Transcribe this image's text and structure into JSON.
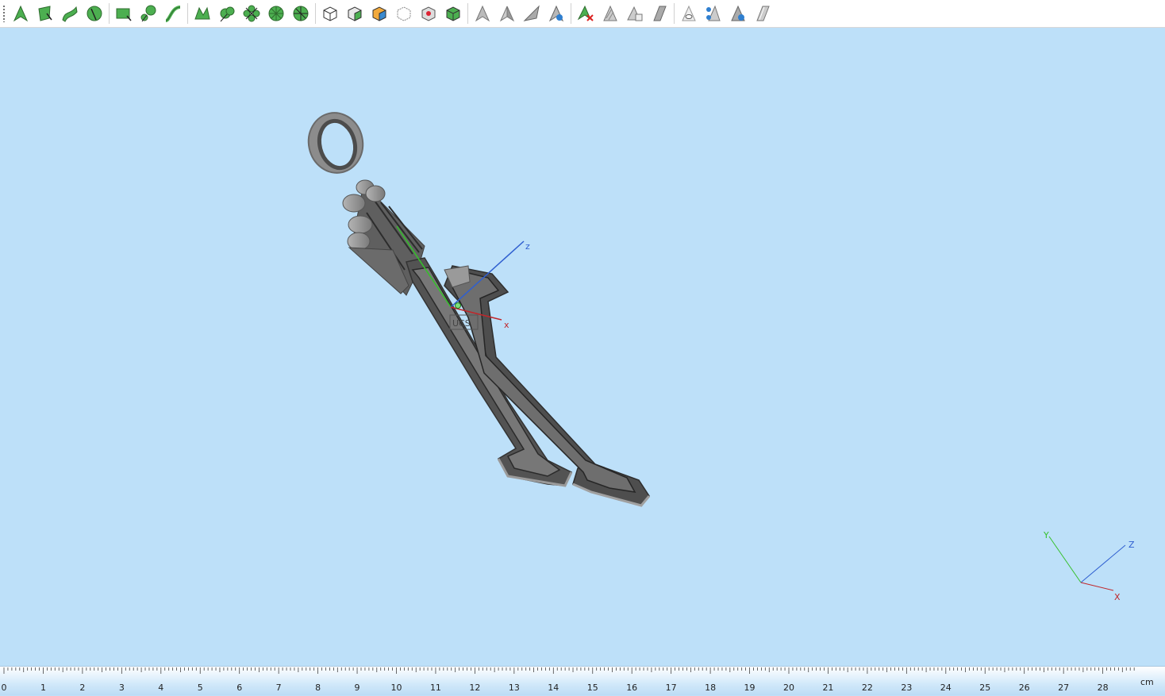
{
  "toolbar": {
    "groups": [
      [
        {
          "name": "select-curve-tool",
          "icon": "arrow-select-icon"
        },
        {
          "name": "select-surface-tool",
          "icon": "surface-select-icon"
        },
        {
          "name": "select-freeform-tool",
          "icon": "freeform-select-icon"
        },
        {
          "name": "select-round-tool",
          "icon": "round-select-icon"
        }
      ],
      [
        {
          "name": "rectangle-patch-tool",
          "icon": "rectangle-patch-icon"
        },
        {
          "name": "node-link-tool",
          "icon": "node-link-icon"
        },
        {
          "name": "curve-sweep-tool",
          "icon": "curve-sweep-icon"
        }
      ],
      [
        {
          "name": "trim-tool",
          "icon": "trim-icon"
        },
        {
          "name": "blend-tool",
          "icon": "blend-icon"
        },
        {
          "name": "flower-pattern-tool",
          "icon": "flower-pattern-icon"
        },
        {
          "name": "radial-pattern-tool",
          "icon": "radial-pattern-icon"
        },
        {
          "name": "radial-cut-tool",
          "icon": "radial-cut-icon"
        }
      ],
      [
        {
          "name": "box-view-tool",
          "icon": "box-icon"
        },
        {
          "name": "box-shaded-tool",
          "icon": "box-shaded-icon"
        },
        {
          "name": "box-colored-tool",
          "icon": "box-colored-icon"
        },
        {
          "name": "box-wire-tool",
          "icon": "box-wire-icon"
        },
        {
          "name": "box-red-point-tool",
          "icon": "box-red-point-icon"
        },
        {
          "name": "box-green-tool",
          "icon": "box-green-icon"
        }
      ],
      [
        {
          "name": "pointer-gray-tool",
          "icon": "pointer-gray-icon"
        },
        {
          "name": "pointer-split-tool",
          "icon": "pointer-split-icon"
        },
        {
          "name": "pointer-plane-tool",
          "icon": "pointer-plane-icon"
        },
        {
          "name": "pointer-blue-tool",
          "icon": "pointer-blue-icon"
        }
      ],
      [
        {
          "name": "delete-pointer-tool",
          "icon": "delete-pointer-icon"
        },
        {
          "name": "hatch-pointer-tool",
          "icon": "hatch-pointer-icon"
        },
        {
          "name": "copy-pointer-tool",
          "icon": "copy-pointer-icon"
        },
        {
          "name": "slanted-plane-tool",
          "icon": "slanted-plane-icon"
        }
      ],
      [
        {
          "name": "eye-pointer-tool",
          "icon": "eye-pointer-icon"
        },
        {
          "name": "multi-eye-tool",
          "icon": "multi-eye-icon"
        },
        {
          "name": "blue-eye-tool",
          "icon": "blue-eye-icon"
        },
        {
          "name": "plane-outline-tool",
          "icon": "plane-outline-icon"
        }
      ]
    ]
  },
  "viewport": {
    "background": "#bde0f9",
    "model_color": "#8a8a8a",
    "ucs": {
      "label": "UCS",
      "x_label": "x",
      "z_label": "z",
      "x_color": "#c0262a",
      "y_color": "#35c02b",
      "z_color": "#2f5fd0"
    },
    "corner_axes": {
      "x_label": "X",
      "y_label": "Y",
      "z_label": "Z"
    }
  },
  "ruler": {
    "labels": [
      "0",
      "1",
      "2",
      "3",
      "4",
      "5",
      "6",
      "7",
      "8",
      "9",
      "10",
      "11",
      "12",
      "13",
      "14",
      "15",
      "16",
      "17",
      "18",
      "19",
      "20",
      "21",
      "22",
      "23",
      "24",
      "25",
      "26",
      "27",
      "28"
    ],
    "unit": "cm"
  }
}
